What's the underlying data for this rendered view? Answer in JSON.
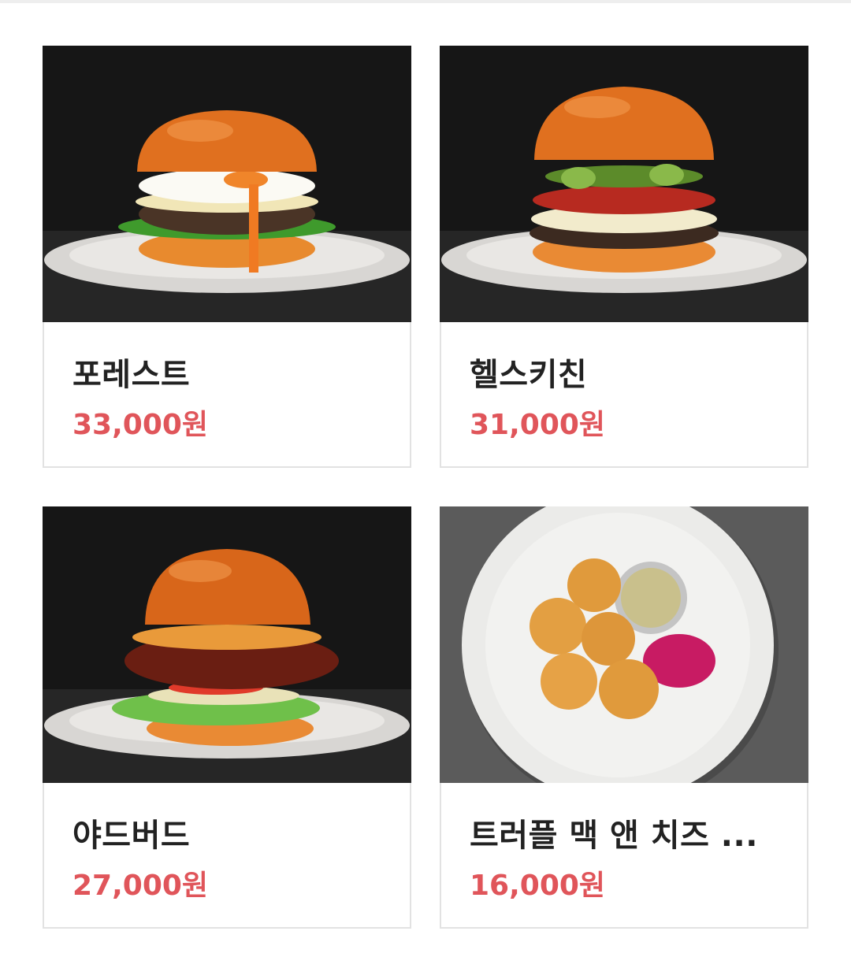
{
  "accent_color": "#e0555a",
  "menu_items": [
    {
      "name": "포레스트",
      "price": "33,000원",
      "image": "burger-with-fried-egg-and-arugula"
    },
    {
      "name": "헬스키친",
      "price": "31,000원",
      "image": "burger-with-avocado-and-pepperoni"
    },
    {
      "name": "야드버드",
      "price": "27,000원",
      "image": "fried-chicken-burger-with-slaw"
    },
    {
      "name": "트러플 맥 앤 치즈 ...",
      "price": "16,000원",
      "image": "truffle-mac-and-cheese-balls-with-dip"
    }
  ]
}
